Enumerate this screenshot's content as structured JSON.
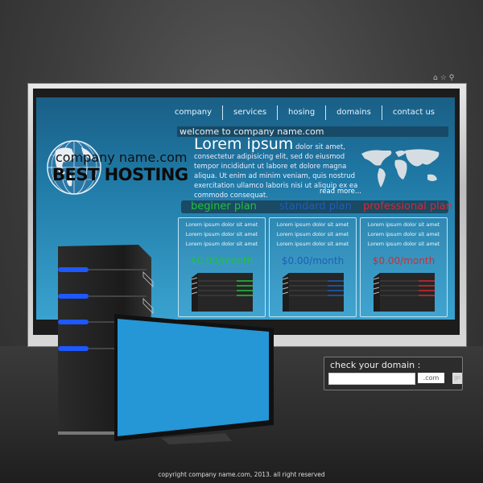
{
  "browser_icons": [
    {
      "name": "home-icon",
      "glyph": "⌂"
    },
    {
      "name": "star-icon",
      "glyph": "☆"
    },
    {
      "name": "search-icon",
      "glyph": "⚲"
    }
  ],
  "nav": [
    "company",
    "services",
    "hosing",
    "domains",
    "contact us"
  ],
  "welcome": "welcome to company name.com",
  "logo": {
    "name": "company name.com",
    "title": "BEST HOSTING"
  },
  "intro": {
    "headline": "Lorem ipsum",
    "body": " dolor sit amet, consectetur adipisicing elit, sed do eiusmod tempor incididunt ut labore et dolore magna aliqua. Ut enim ad minim veniam, quis nostrud exercitation ullamco laboris nisi ut aliquip ex ea commodo consequat.",
    "read_more": "read more..."
  },
  "plans": [
    {
      "name": "beginer plan",
      "color": "#22c33a",
      "features": [
        "Lorem ipsum dolor sit amet",
        "Lorem ipsum dolor sit amet",
        "Lorem ipsum dolor sit amet"
      ],
      "price": "$0.00/month"
    },
    {
      "name": "standard plan",
      "color": "#1e5fb8",
      "features": [
        "Lorem ipsum dolor sit amet",
        "Lorem ipsum dolor sit amet",
        "Lorem ipsum dolor sit amet"
      ],
      "price": "$0.00/month"
    },
    {
      "name": "professional plan",
      "color": "#d42a32",
      "features": [
        "Lorem ipsum dolor sit amet",
        "Lorem ipsum dolor sit amet",
        "Lorem ipsum dolor sit amet"
      ],
      "price": "$0.00/month"
    }
  ],
  "domain": {
    "label": "check your domain :",
    "value": "",
    "tld": ".com",
    "go": "go"
  },
  "footer": "copyright company name.com, 2013. all right reserved"
}
